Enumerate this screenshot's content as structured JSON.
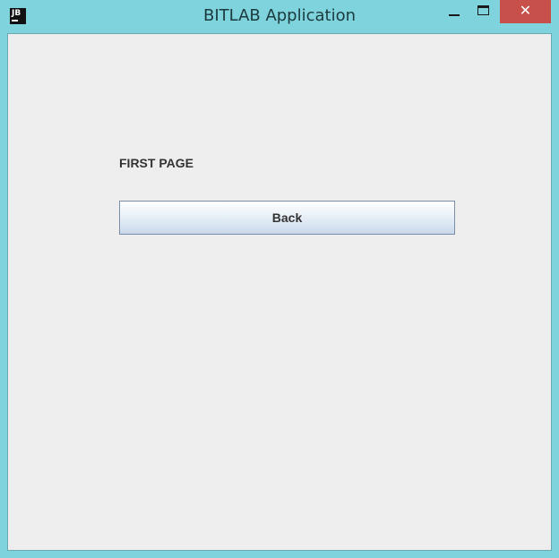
{
  "window": {
    "title": "BITLAB Application",
    "app_icon_text": "JB",
    "close_glyph": "✕"
  },
  "main": {
    "page_label": "FIRST PAGE",
    "back_button_label": "Back"
  },
  "colors": {
    "frame": "#7fd3dc",
    "content_bg": "#eeeeee",
    "close_button": "#c7504b"
  }
}
